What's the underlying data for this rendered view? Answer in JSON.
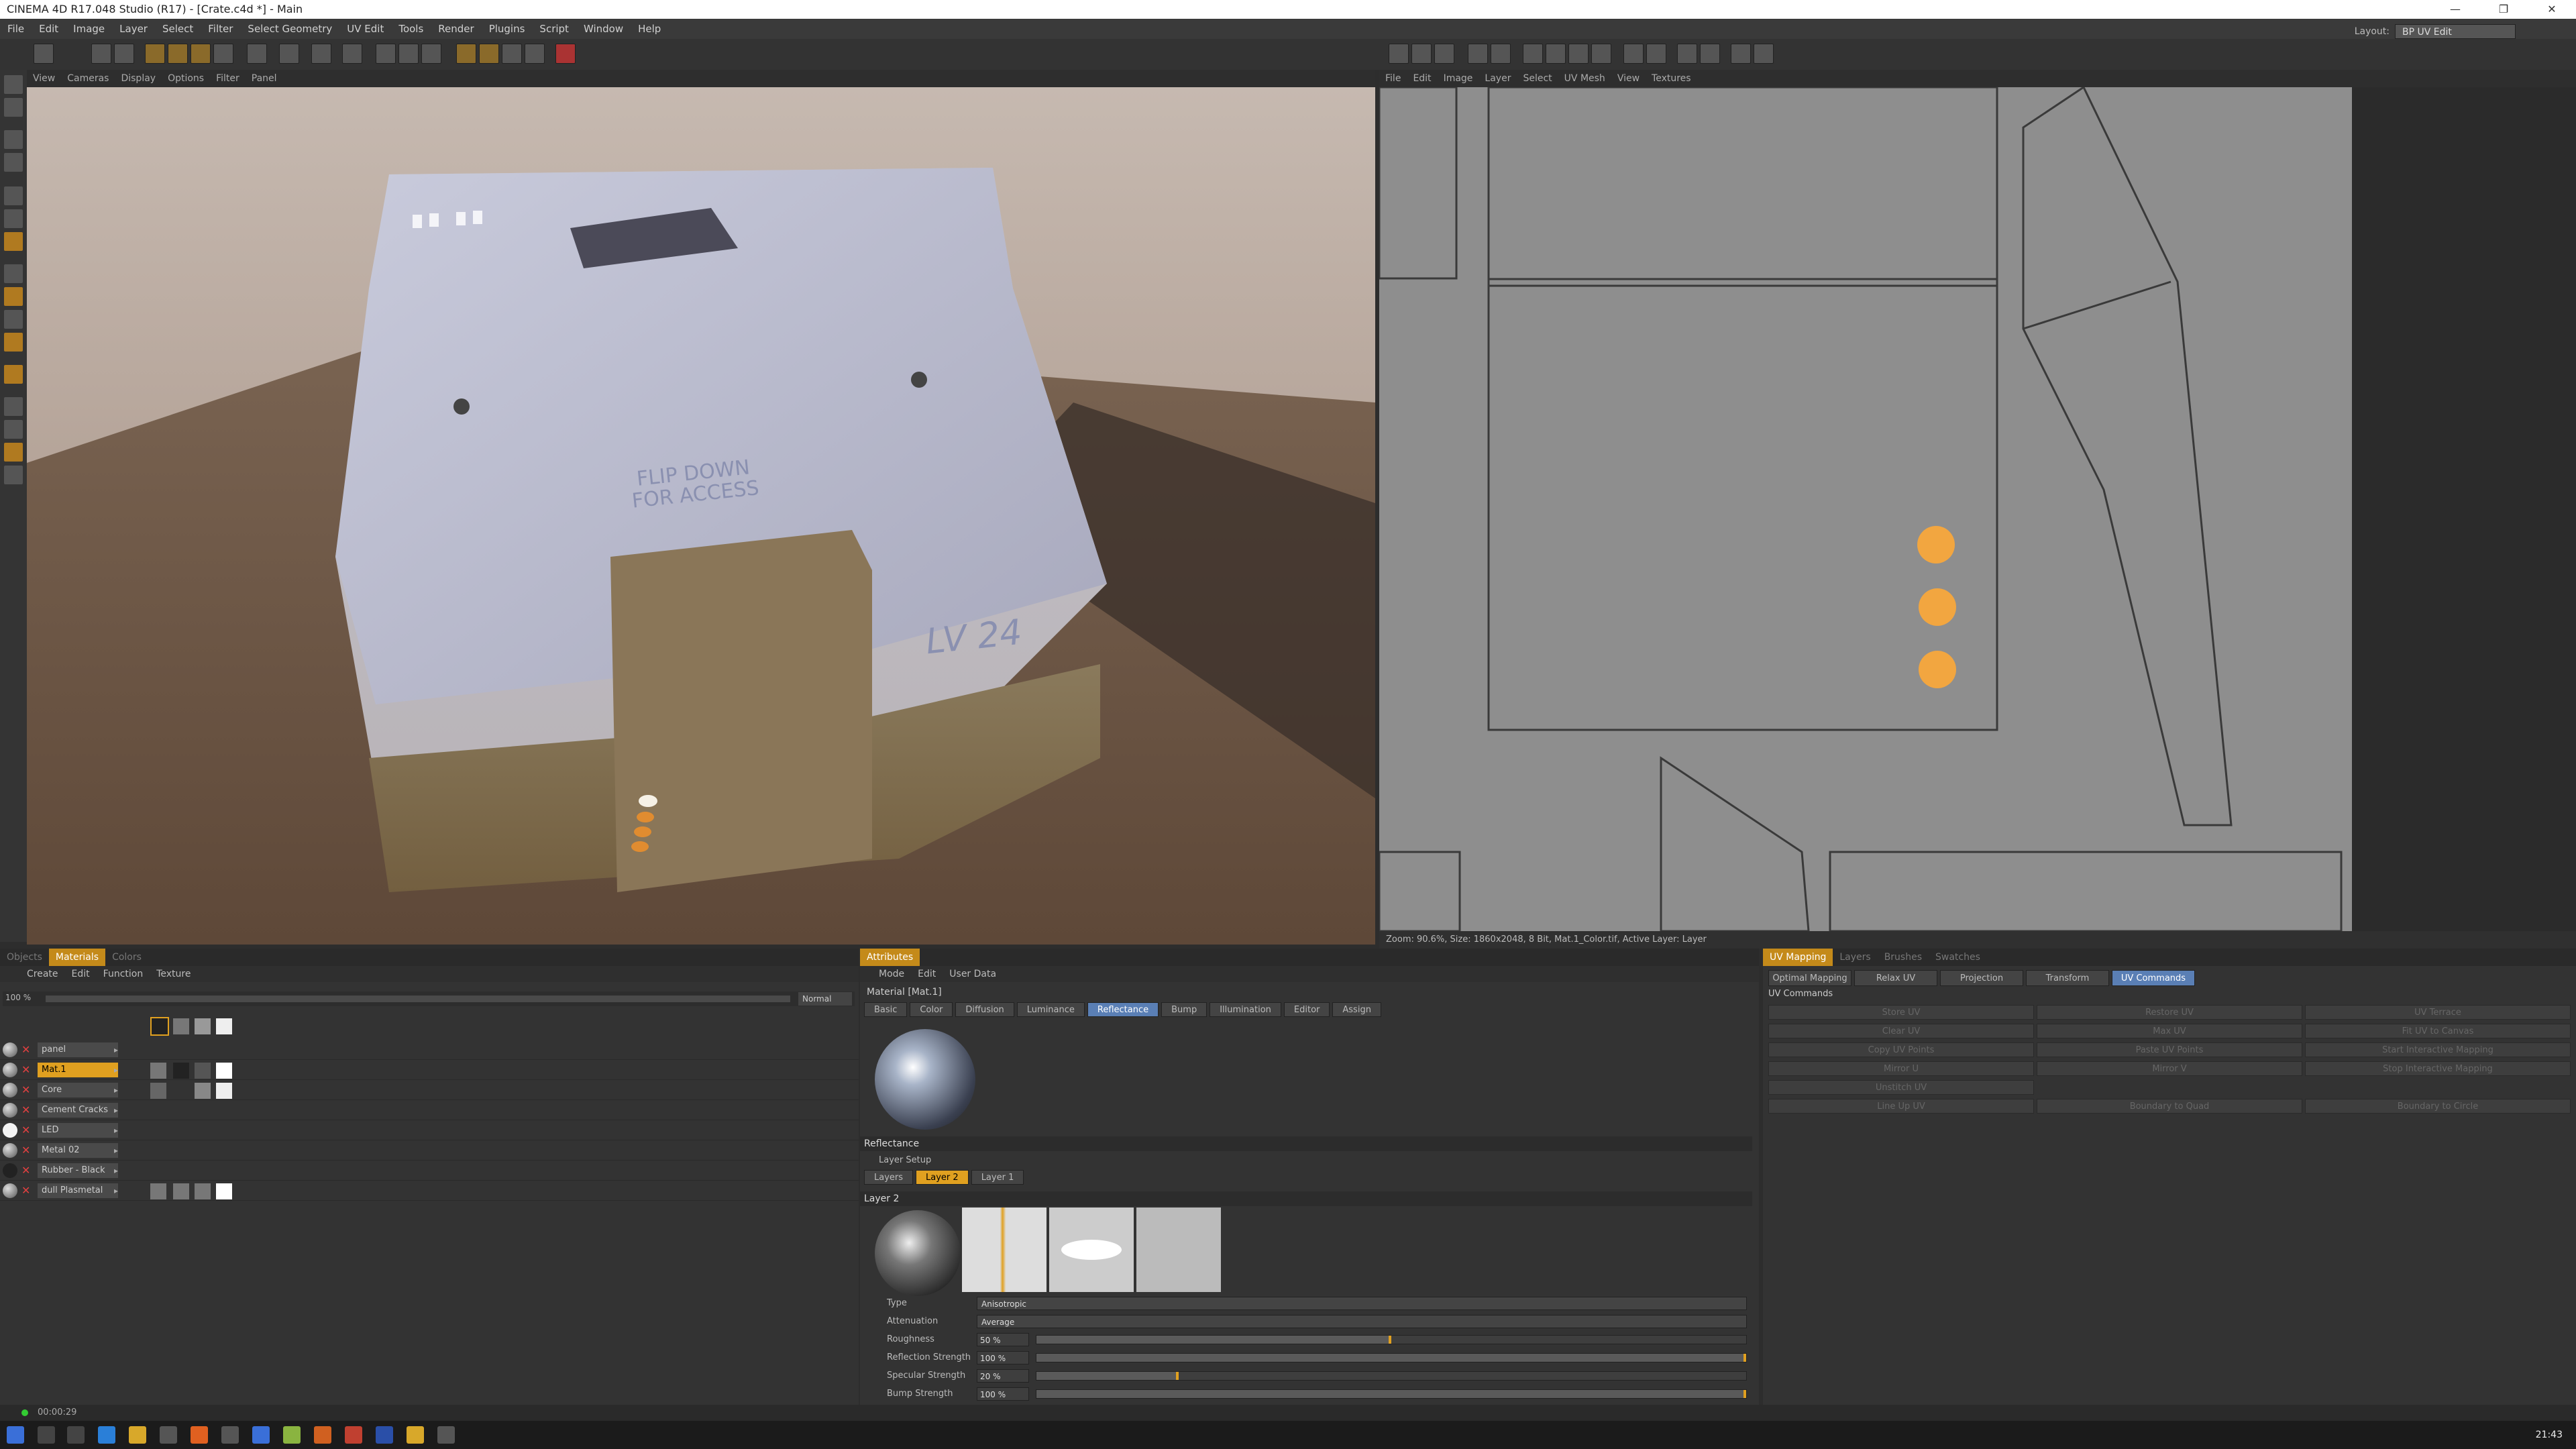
{
  "titlebar": {
    "title": "CINEMA 4D R17.048 Studio (R17) - [Crate.c4d *] - Main",
    "minimize": "—",
    "restore": "❐",
    "close": "✕"
  },
  "menubar": [
    "File",
    "Edit",
    "Image",
    "Layer",
    "Select",
    "Filter",
    "Select Geometry",
    "UV Edit",
    "Tools",
    "Render",
    "Plugins",
    "Script",
    "Window",
    "Help"
  ],
  "layout": {
    "label": "Layout:",
    "value": "BP UV Edit"
  },
  "viewport": {
    "menu": [
      "View",
      "Cameras",
      "Display",
      "Options",
      "Filter",
      "Panel"
    ],
    "scene_text": {
      "decal": "FLIP DOWN\nFOR ACCESS",
      "code": "LV 24"
    }
  },
  "uv_editor": {
    "menu": [
      "File",
      "Edit",
      "Image",
      "Layer",
      "Select",
      "UV Mesh",
      "View",
      "Textures"
    ],
    "status": "Zoom: 90.6%, Size: 1860x2048, 8 Bit, Mat.1_Color.tif, Active Layer: Layer"
  },
  "materials_panel": {
    "tabs": [
      "Objects",
      "Materials",
      "Colors"
    ],
    "active_tab": "Materials",
    "menu": [
      "Create",
      "Edit",
      "Function",
      "Texture"
    ],
    "zoom": "100 %",
    "blend_mode": "Normal",
    "materials": [
      "panel",
      "Mat.1",
      "Core",
      "Cement Cracks",
      "LED",
      "Metal 02",
      "Rubber - Black",
      "dull Plasmetal"
    ],
    "selected": "Mat.1"
  },
  "attributes_panel": {
    "tab": "Attributes",
    "menu": [
      "Mode",
      "Edit",
      "User Data"
    ],
    "material_title": "Material [Mat.1]",
    "channel_tabs": [
      "Basic",
      "Color",
      "Diffusion",
      "Luminance",
      "Reflectance",
      "Bump",
      "Illumination",
      "Editor",
      "Assign"
    ],
    "active_channel": "Reflectance",
    "section": "Reflectance",
    "layer_setup": "Layer Setup",
    "layer_tabs": [
      "Layers",
      "Layer 2",
      "Layer 1"
    ],
    "active_layer": "Layer 2",
    "layer_title": "Layer 2",
    "params": {
      "type": {
        "label": "Type",
        "value": "Anisotropic"
      },
      "attenuation": {
        "label": "Attenuation",
        "value": "Average"
      },
      "roughness": {
        "label": "Roughness",
        "value": "50 %",
        "level": 0.5
      },
      "reflection_strength": {
        "label": "Reflection Strength",
        "value": "100 %",
        "level": 1.0
      },
      "specular_strength": {
        "label": "Specular Strength",
        "value": "20 %",
        "level": 0.2
      },
      "bump_strength": {
        "label": "Bump Strength",
        "value": "100 %",
        "level": 1.0
      }
    }
  },
  "uv_panel": {
    "tabs": [
      "UV Mapping",
      "Layers",
      "Brushes",
      "Swatches"
    ],
    "active_tab": "UV Mapping",
    "sub_tabs": [
      "Optimal Mapping",
      "Relax UV",
      "Projection",
      "Transform",
      "UV Commands"
    ],
    "active_sub_tab": "UV Commands",
    "section": "UV Commands",
    "commands": [
      [
        "Store UV",
        "Restore UV",
        "UV Terrace"
      ],
      [
        "Clear UV",
        "Max UV",
        "Fit UV to Canvas"
      ],
      [
        "Copy UV Points",
        "Paste UV Points",
        "Start Interactive Mapping"
      ],
      [
        "Mirror U",
        "Mirror V",
        "Stop Interactive Mapping"
      ],
      [
        "Unstitch UV",
        "",
        ""
      ],
      [
        "Line Up UV",
        "Boundary to Quad",
        "Boundary to Circle"
      ]
    ]
  },
  "status": {
    "time": "00:00:29"
  },
  "taskbar": {
    "clock": "21:43"
  },
  "colors": {
    "accent": "#e0a020",
    "active_blue": "#5a7fb5",
    "led_orange": "#f2a640"
  }
}
